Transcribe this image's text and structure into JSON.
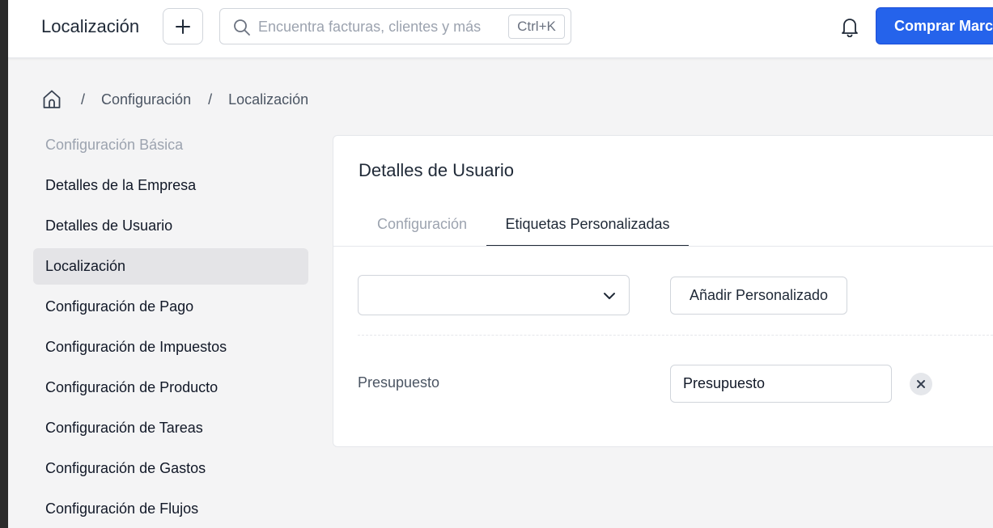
{
  "header": {
    "title": "Localización",
    "add_icon": "plus-icon",
    "search": {
      "placeholder": "Encuentra facturas, clientes y más",
      "shortcut": "Ctrl+K",
      "icon": "search-icon"
    },
    "notifications_icon": "bell-icon",
    "buy_button_label": "Comprar Marca",
    "accent_color": "#2563eb"
  },
  "breadcrumb": {
    "home_icon": "home-icon",
    "separator": "/",
    "items": [
      "Configuración",
      "Localización"
    ]
  },
  "sidebar": {
    "section_title": "Configuración Básica",
    "items": [
      {
        "label": "Detalles de la Empresa",
        "active": false
      },
      {
        "label": "Detalles de Usuario",
        "active": false
      },
      {
        "label": "Localización",
        "active": true
      },
      {
        "label": "Configuración de Pago",
        "active": false
      },
      {
        "label": "Configuración de Impuestos",
        "active": false
      },
      {
        "label": "Configuración de Producto",
        "active": false
      },
      {
        "label": "Configuración de Tareas",
        "active": false
      },
      {
        "label": "Configuración de Gastos",
        "active": false
      },
      {
        "label": "Configuración de Flujos",
        "active": false
      }
    ]
  },
  "card": {
    "title": "Detalles de Usuario",
    "tabs": [
      {
        "label": "Configuración",
        "active": false
      },
      {
        "label": "Etiquetas Personalizadas",
        "active": true
      }
    ],
    "select_value": "",
    "add_button_label": "Añadir Personalizado",
    "custom_label": {
      "name": "Presupuesto",
      "value": "Presupuesto"
    }
  }
}
